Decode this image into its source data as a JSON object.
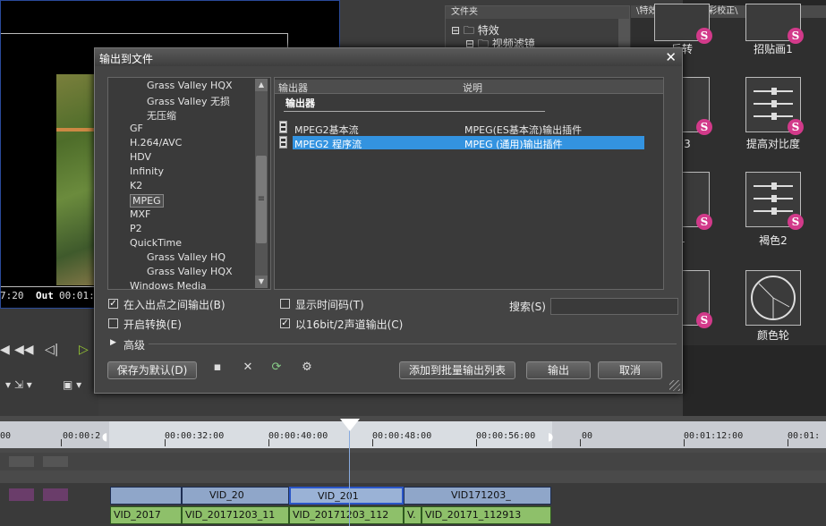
{
  "background": {
    "preview_times": {
      "left": "7:20",
      "out_label": "Out",
      "out_value": "00:01:"
    },
    "fx_tree": {
      "header": "文件夹",
      "items": [
        {
          "label": "特效"
        },
        {
          "label": "视频滤镜"
        }
      ]
    },
    "fx_path": "\\特效\\视频滤镜\\色彩校正\\",
    "fx_tiles": [
      {
        "label": "反转"
      },
      {
        "label": "招贴画1"
      },
      {
        "label": "画3"
      },
      {
        "label": "提高对比度"
      },
      {
        "label": "1"
      },
      {
        "label": "褐色2"
      },
      {
        "label": ""
      },
      {
        "label": "颜色轮"
      }
    ],
    "ruler_labels": [
      "00",
      "00:00:2",
      "00:00:32:00",
      "00:00:40:00",
      "00:00:48:00",
      "00:00:56:00",
      "00",
      "00:01:12:00",
      "00:01:"
    ],
    "video_clips": [
      "",
      "VID_20",
      "VID_201",
      "VID171203_"
    ],
    "audio_clips": [
      "VID_2017",
      "VID_20171203_11",
      "VID_20171203_112",
      "V.",
      "VID_20171_112913"
    ],
    "clip_short": "VID_20171203_11"
  },
  "dialog": {
    "title": "输出到文件",
    "close_symbol": "✕",
    "formats": [
      {
        "label": "Grass Valley HQX",
        "indent": 2
      },
      {
        "label": "Grass Valley 无损",
        "indent": 2
      },
      {
        "label": "无压缩",
        "indent": 2
      },
      {
        "label": "GF",
        "indent": 1
      },
      {
        "label": "H.264/AVC",
        "indent": 1
      },
      {
        "label": "HDV",
        "indent": 1
      },
      {
        "label": "Infinity",
        "indent": 1
      },
      {
        "label": "K2",
        "indent": 1
      },
      {
        "label": "MPEG",
        "indent": 1,
        "selected": true
      },
      {
        "label": "MXF",
        "indent": 1
      },
      {
        "label": "P2",
        "indent": 1
      },
      {
        "label": "QuickTime",
        "indent": 1
      },
      {
        "label": "Grass Valley HQ",
        "indent": 2
      },
      {
        "label": "Grass Valley HQX",
        "indent": 2
      },
      {
        "label": "Windows Media",
        "indent": 1
      }
    ],
    "exporter_columns": {
      "col1": "输出器",
      "col2": "说明"
    },
    "exporter_group": "输出器",
    "exporters": [
      {
        "name": "MPEG2基本流",
        "desc": "MPEG(ES基本流)输出插件",
        "selected": false
      },
      {
        "name": "MPEG2 程序流",
        "desc": "MPEG (通用)输出插件",
        "selected": true
      }
    ],
    "options": {
      "in_out": {
        "label": "在入出点之间输出(B)",
        "checked": true
      },
      "convert": {
        "label": "开启转换(E)",
        "checked": false
      },
      "timecode": {
        "label": "显示时间码(T)",
        "checked": false
      },
      "audio16": {
        "label": "以16bit/2声道输出(C)",
        "checked": true
      }
    },
    "search": {
      "label": "搜索(S)",
      "value": ""
    },
    "advanced_label": "高级",
    "buttons": {
      "save_default": "保存为默认(D)",
      "add_batch": "添加到批量输出列表",
      "export": "输出",
      "cancel": "取消"
    },
    "check_mark": "✓"
  }
}
